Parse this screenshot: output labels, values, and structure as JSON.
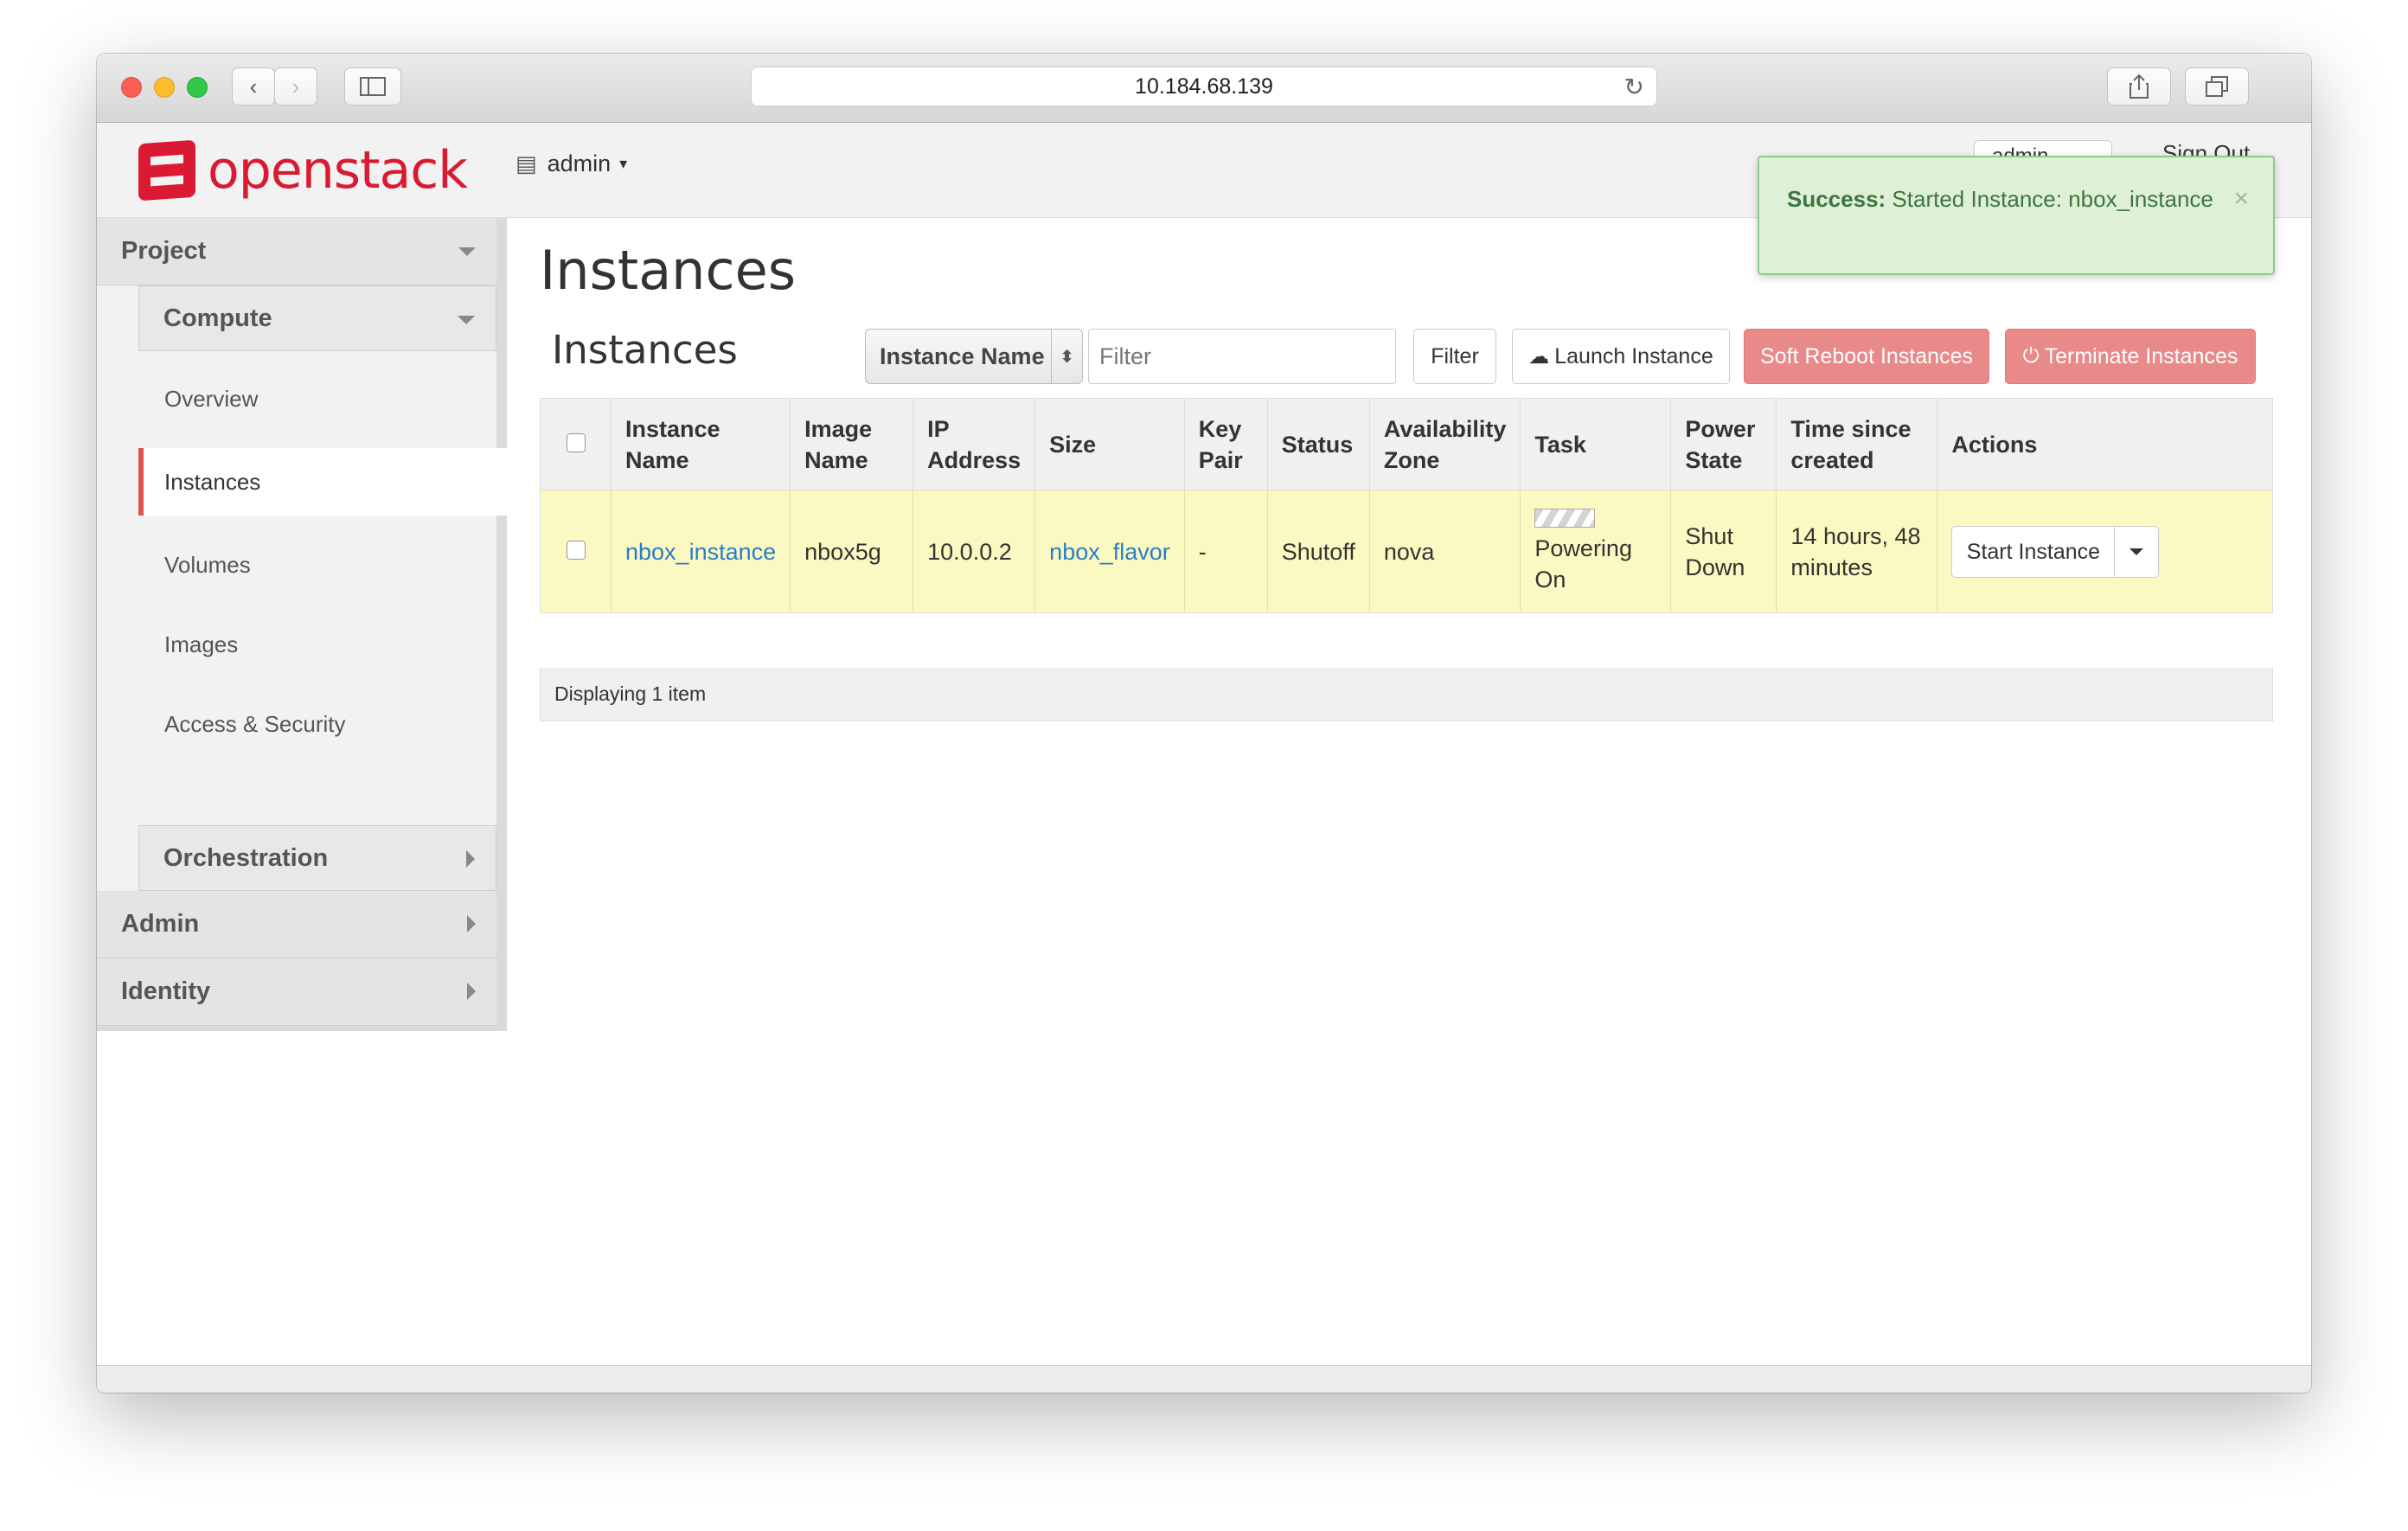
{
  "browser": {
    "url": "10.184.68.139"
  },
  "header": {
    "logo_text": "openstack",
    "project_label": "admin",
    "user_label": "admin",
    "signout_label": "Sign Out"
  },
  "sidebar": {
    "dashboard": "Project",
    "compute_panel": "Compute",
    "items": [
      {
        "label": "Overview"
      },
      {
        "label": "Instances"
      },
      {
        "label": "Volumes"
      },
      {
        "label": "Images"
      },
      {
        "label": "Access & Security"
      }
    ],
    "orchestration_panel": "Orchestration",
    "admin_dashboard": "Admin",
    "identity_dashboard": "Identity"
  },
  "main": {
    "page_title": "Instances",
    "table_title": "Instances",
    "filter_field": "Instance Name",
    "filter_placeholder": "Filter",
    "filter_button": "Filter",
    "launch_button": "Launch Instance",
    "soft_reboot_button": "Soft Reboot Instances",
    "terminate_button": "Terminate Instances",
    "columns": [
      "Instance Name",
      "Image Name",
      "IP Address",
      "Size",
      "Key Pair",
      "Status",
      "Availability Zone",
      "Task",
      "Power State",
      "Time since created",
      "Actions"
    ],
    "rows": [
      {
        "instance_name": "nbox_instance",
        "image_name": "nbox5g",
        "ip_address": "10.0.0.2",
        "size": "nbox_flavor",
        "key_pair": "-",
        "status": "Shutoff",
        "availability_zone": "nova",
        "task": "Powering On",
        "power_state": "Shut Down",
        "time_since_created": "14 hours, 48 minutes",
        "action_label": "Start Instance"
      }
    ],
    "footer": "Displaying 1 item"
  },
  "alert": {
    "title": "Success:",
    "message": "Started Instance: nbox_instance",
    "close_symbol": "×"
  },
  "colors": {
    "accent": "#da1a32",
    "row_highlight": "#fbf9c2",
    "danger_button": "#e8898a",
    "link": "#2a7dc5",
    "success_bg": "#dff0d8"
  },
  "icons": [
    "back-icon",
    "forward-icon",
    "sidebar-toggle-icon",
    "reload-icon",
    "share-icon",
    "tabs-icon",
    "new-tab-icon",
    "project-icon",
    "cloud-upload-icon",
    "power-icon",
    "close-icon"
  ]
}
